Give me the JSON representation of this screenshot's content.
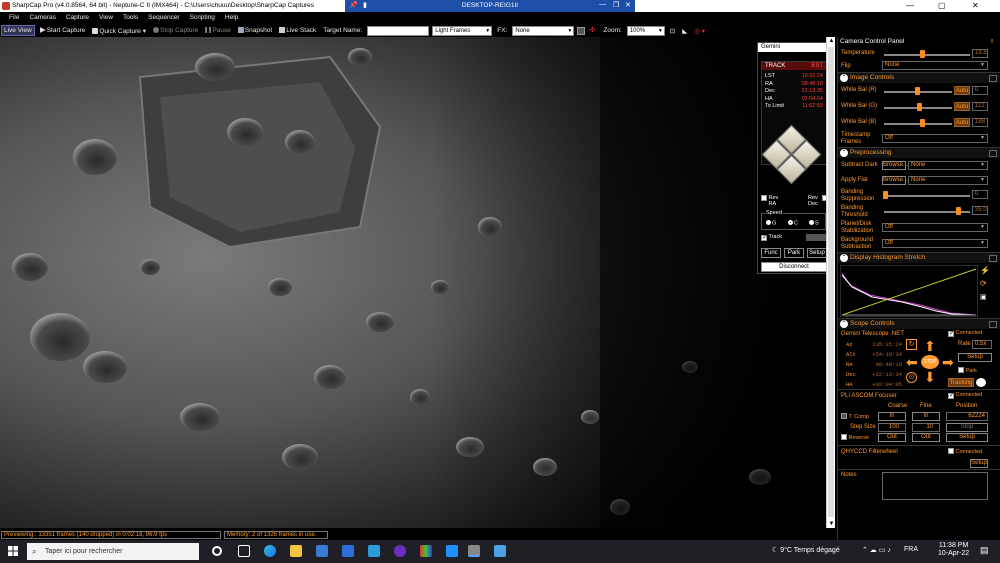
{
  "titlebar": {
    "title": "SharpCap Pro (v4.0.8564, 64 bit) - Neptune-C II (IMX464) - C:\\Users\\chuuu\\Desktop\\SharpCap Captures",
    "rdp_title": "DESKTOP-REIG1II"
  },
  "menu": [
    "File",
    "Cameras",
    "Capture",
    "View",
    "Tools",
    "Sequencer",
    "Scripting",
    "Help"
  ],
  "toolbar": {
    "live_view": "Live View",
    "start_capture": "Start Capture",
    "quick_capture": "Quick Capture",
    "stop_capture": "Stop Capture",
    "pause": "Pause",
    "snapshot": "Snapshot",
    "live_stack": "Live Stack",
    "target_name_label": "Target Name:",
    "target_name_value": "",
    "frame_type": "Light Frames",
    "fx_label": "FX:",
    "fx_value": "None",
    "zoom_label": "Zoom:",
    "zoom_value": "100%"
  },
  "status": {
    "preview": "Previewing : 13351 frames (140 dropped) in 0:02:18, 96.9 fps",
    "memory": "Memory: 2 of 1325 frames in use."
  },
  "gemini": {
    "header": "Gemini",
    "track_label": "TRACK",
    "est_label": "EST",
    "rows": [
      {
        "label": "LST",
        "value": "10:52:24"
      },
      {
        "label": "RA",
        "value": "08:48:18"
      },
      {
        "label": "Dec",
        "value": "22:13:35"
      },
      {
        "label": "HA",
        "value": "02:04:04"
      },
      {
        "label": "To Limit",
        "value": "11:02:59"
      }
    ],
    "rev_ra": "Rev RA",
    "rev_dec": "Rev Dec",
    "speed_label": "Speed",
    "speed_options": [
      "G",
      "C",
      "S"
    ],
    "track_check": "Track",
    "func": "Func",
    "park": "Park",
    "setup": "Setup",
    "disconnect": "Disconnect"
  },
  "panel": {
    "title": "Camera Control Panel",
    "temperature_label": "Temperature",
    "temperature_value": "18.8",
    "flip_label": "Flip",
    "flip_value": "None",
    "image_controls": "Image Controls",
    "wb_r_label": "White Bal (R)",
    "wb_r_value": "0",
    "wb_g_label": "White Bal (G)",
    "wb_g_value": "112",
    "wb_b_label": "White Bal (B)",
    "wb_b_value": "188",
    "auto": "Auto",
    "timestamp_label": "Timestamp Frames",
    "timestamp_value": "Off",
    "preprocessing": "Preprocessing",
    "subtract_dark": "Subtract Dark",
    "apply_flat": "Apply Flat",
    "browse": "Browse...",
    "none": "None",
    "banding_supp_label": "Banding Suppression",
    "banding_supp_value": "0",
    "banding_thr_label": "Banding Threshold",
    "banding_thr_value": "35.0",
    "planet_stab_label": "Planet/Disk Stabilization",
    "planet_stab_value": "Off",
    "bg_sub_label": "Background Subtraction",
    "bg_sub_value": "Off",
    "histogram": "Display Histogram Stretch",
    "scope_controls": "Scope Controls",
    "telescope_name": "Gemini Telescope .NET",
    "connected": "Connected",
    "scope_rows": [
      {
        "label": "Az",
        "value": "235:35:24"
      },
      {
        "label": "Alt",
        "value": "+54:10:34"
      },
      {
        "label": "RA",
        "value": "08:48:18"
      },
      {
        "label": "Dec",
        "value": "+22:13:34"
      },
      {
        "label": "HA",
        "value": "+02:04:05"
      }
    ],
    "rate_label": "Rate",
    "rate_value": "0.5x",
    "setup": "Setup",
    "park": "Park",
    "stop": "STOP",
    "tracking": "Tracking",
    "focuser_name": "PLI ASCOM Focuser",
    "coarse": "Coarse",
    "fine": "Fine",
    "position": "Position",
    "tcomp": "T. Comp",
    "in_label": "In",
    "out_label": "Out",
    "position_value": "62224",
    "step_size": "Step Size",
    "coarse_step": "100",
    "fine_step": "10",
    "stop_btn": "Stop",
    "reverse": "Reverse",
    "filterwheel": "QHYCCD Filterwheel",
    "notes": "Notes"
  },
  "taskbar": {
    "search_placeholder": "Taper ici pour rechercher",
    "weather": "9°C  Temps dégagé",
    "lang": "FRA",
    "time": "11:38 PM",
    "date": "10-Apr-22"
  },
  "colors": {
    "accent_orange": "#ff9a2e",
    "red_value": "#ff3b3b",
    "rdp_blue": "#1e4fa6"
  }
}
